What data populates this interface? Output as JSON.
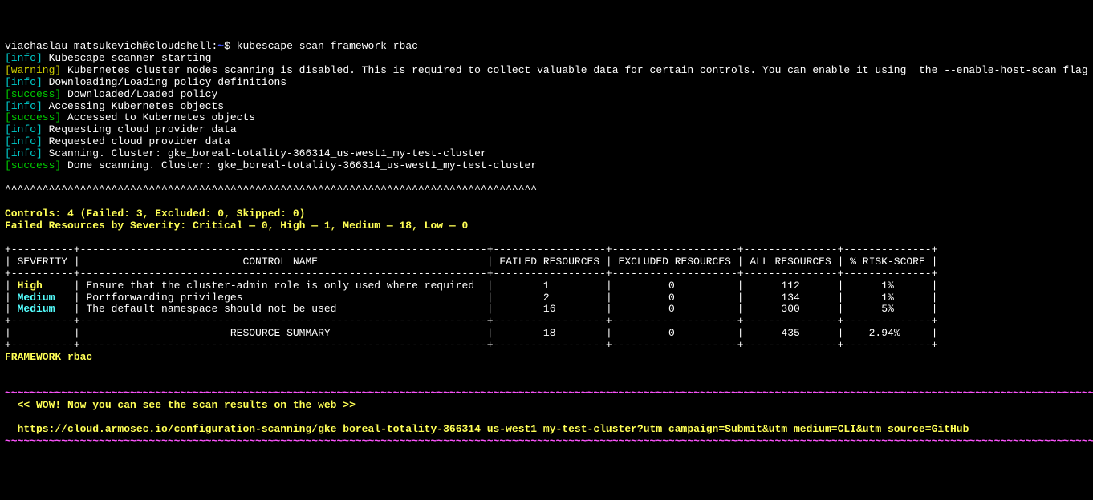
{
  "prompt": {
    "user_host": "viachaslau_matsukevich@cloudshell",
    "path": "~",
    "sep": "$",
    "command": "kubescape scan framework rbac"
  },
  "lines": [
    {
      "tag": "info",
      "text": "Kubescape scanner starting"
    },
    {
      "tag": "warning",
      "text": "Kubernetes cluster nodes scanning is disabled. This is required to collect valuable data for certain controls. You can enable it using  the --enable-host-scan flag"
    },
    {
      "tag": "info",
      "text": "Downloading/Loading policy definitions"
    },
    {
      "tag": "success",
      "text": "Downloaded/Loaded policy"
    },
    {
      "tag": "info",
      "text": "Accessing Kubernetes objects"
    },
    {
      "tag": "success",
      "text": "Accessed to Kubernetes objects"
    },
    {
      "tag": "info",
      "text": "Requesting cloud provider data"
    },
    {
      "tag": "info",
      "text": "Requested cloud provider data"
    },
    {
      "tag": "info",
      "text": "Scanning. Cluster: gke_boreal-totality-366314_us-west1_my-test-cluster"
    },
    {
      "tag": "success",
      "text": "Done scanning. Cluster: gke_boreal-totality-366314_us-west1_my-test-cluster"
    }
  ],
  "carets": "^^^^^^^^^^^^^^^^^^^^^^^^^^^^^^^^^^^^^^^^^^^^^^^^^^^^^^^^^^^^^^^^^^^^^^^^^^^^^^^^^^^^^",
  "controls_line": "Controls: 4 (Failed: 3, Excluded: 0, Skipped: 0)",
  "severity_line": "Failed Resources by Severity: Critical — 0, High — 1, Medium — 18, Low — 0",
  "table": {
    "border_top": "+----------+-----------------------------------------------------------------+------------------+--------------------+---------------+--------------+",
    "header": "| SEVERITY |                          CONTROL NAME                           | FAILED RESOURCES | EXCLUDED RESOURCES | ALL RESOURCES | % RISK-SCORE |",
    "border_sep": "+----------+-----------------------------------------------------------------+------------------+--------------------+---------------+--------------+",
    "rows": [
      {
        "sev": "High",
        "name": "Ensure that the cluster-admin role is only used where required",
        "failed": "1",
        "excluded": "0",
        "all": "112",
        "risk": "1%"
      },
      {
        "sev": "Medium",
        "name": "Portforwarding privileges",
        "failed": "2",
        "excluded": "0",
        "all": "134",
        "risk": "1%"
      },
      {
        "sev": "Medium",
        "name": "The default namespace should not be used",
        "failed": "16",
        "excluded": "0",
        "all": "300",
        "risk": "5%"
      }
    ],
    "border_mid": "+----------+-----------------------------------------------------------------+------------------+--------------------+---------------+--------------+",
    "summary": {
      "label": "RESOURCE SUMMARY",
      "failed": "18",
      "excluded": "0",
      "all": "435",
      "risk": "2.94%"
    },
    "border_bot": "+----------+-----------------------------------------------------------------+------------------+--------------------+---------------+--------------+"
  },
  "framework_line": "FRAMEWORK rbac",
  "tilde_line": "~~~~~~~~~~~~~~~~~~~~~~~~~~~~~~~~~~~~~~~~~~~~~~~~~~~~~~~~~~~~~~~~~~~~~~~~~~~~~~~~~~~~~~~~~~~~~~~~~~~~~~~~~~~~~~~~~~~~~~~~~~~~~~~~~~~~~~~~~~~~~~~~~~~~~~~~~~~~~~~~~~~~~~~~~~~~~~~~~~",
  "wow_line": "  << WOW! Now you can see the scan results on the web >>",
  "url_line": "  https://cloud.armosec.io/configuration-scanning/gke_boreal-totality-366314_us-west1_my-test-cluster?utm_campaign=Submit&utm_medium=CLI&utm_source=GitHub"
}
